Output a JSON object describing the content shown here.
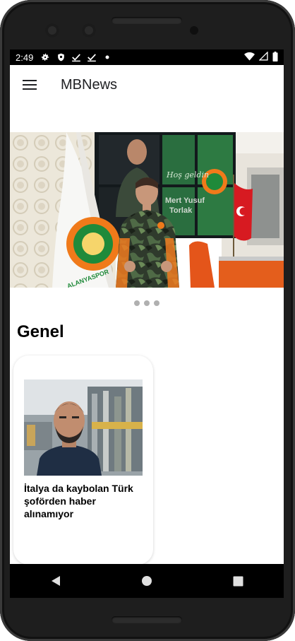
{
  "status_bar": {
    "time": "2:49",
    "icons": [
      "settings-icon",
      "shield-icon",
      "check-download-icon",
      "check-download-icon",
      "dot-icon"
    ],
    "right_icons": [
      "wifi-icon",
      "cell-signal-icon",
      "battery-icon"
    ]
  },
  "app_bar": {
    "title": "MBNews",
    "menu_icon": "hamburger-menu-icon"
  },
  "carousel": {
    "page_count": 3,
    "current_page": 1,
    "image_text": {
      "banner_line1": "Hoş geldin",
      "banner_line2": "Mert Yusuf",
      "banner_line3": "Torlak",
      "flag_text": "ALANYASPOR"
    }
  },
  "section": {
    "title": "Genel"
  },
  "cards": [
    {
      "headline": "İtalya da kaybolan Türk şoförden haber alınamıyor"
    }
  ],
  "nav_bar": {
    "back_icon": "back-triangle-icon",
    "home_icon": "home-circle-icon",
    "recents_icon": "recents-square-icon"
  },
  "colors": {
    "device_frame": "#1e1e1e",
    "status_bar_bg": "#000000",
    "app_bg": "#ffffff",
    "dot": "#b0b0b0",
    "accent_orange": "#f07a1a",
    "accent_green": "#1f8a3a"
  }
}
